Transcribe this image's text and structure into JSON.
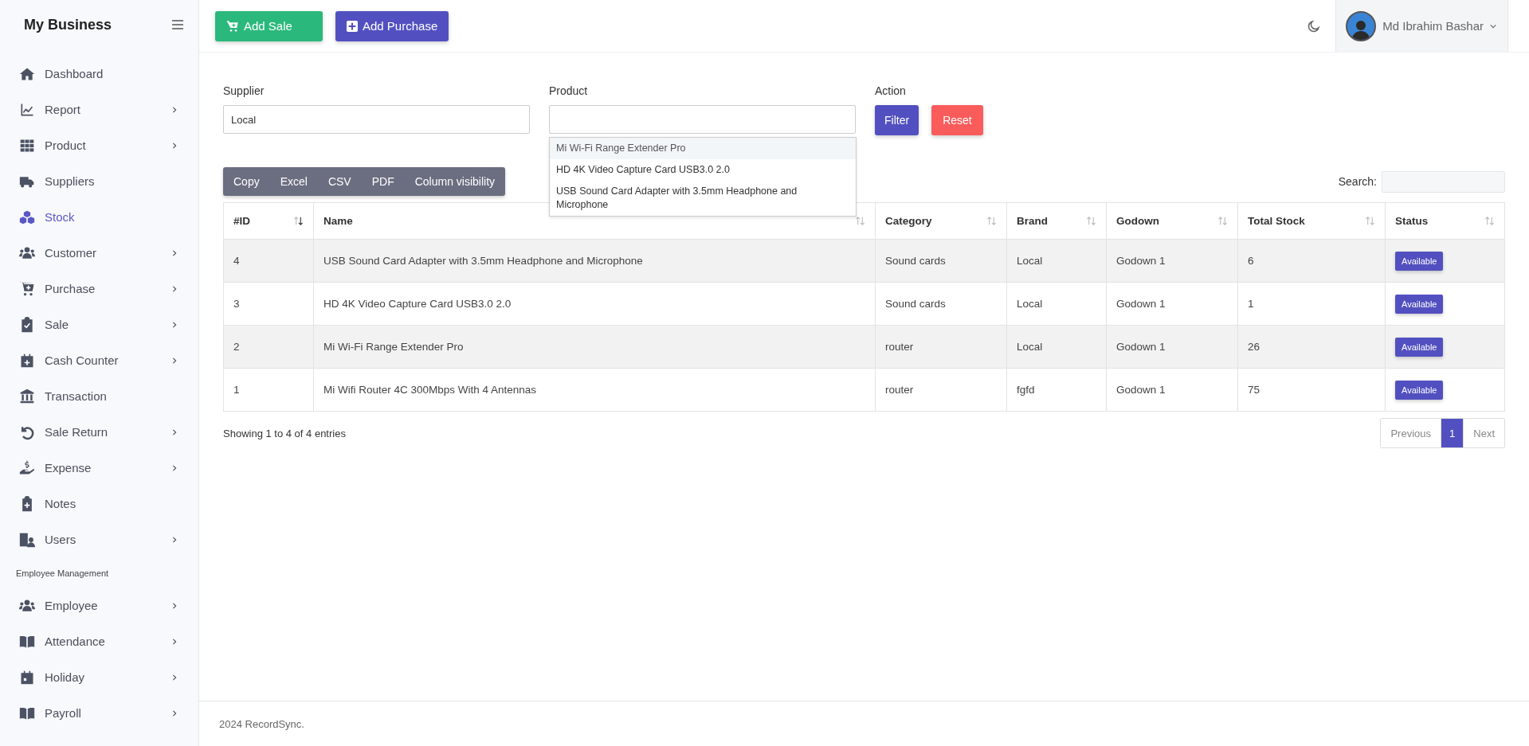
{
  "sidebar": {
    "brand": "My Business",
    "items": [
      {
        "kind": "link",
        "label": "Dashboard",
        "expandable": false,
        "selected": false
      },
      {
        "kind": "link",
        "label": "Report",
        "expandable": true,
        "selected": false
      },
      {
        "kind": "link",
        "label": "Product",
        "expandable": true,
        "selected": false
      },
      {
        "kind": "link",
        "label": "Suppliers",
        "expandable": false,
        "selected": false
      },
      {
        "kind": "link",
        "label": "Stock",
        "expandable": false,
        "selected": true
      },
      {
        "kind": "link",
        "label": "Customer",
        "expandable": true,
        "selected": false
      },
      {
        "kind": "link",
        "label": "Purchase",
        "expandable": true,
        "selected": false
      },
      {
        "kind": "link",
        "label": "Sale",
        "expandable": true,
        "selected": false
      },
      {
        "kind": "link",
        "label": "Cash Counter",
        "expandable": true,
        "selected": false
      },
      {
        "kind": "link",
        "label": "Transaction",
        "expandable": false,
        "selected": false
      },
      {
        "kind": "link",
        "label": "Sale Return",
        "expandable": true,
        "selected": false
      },
      {
        "kind": "link",
        "label": "Expense",
        "expandable": true,
        "selected": false
      },
      {
        "kind": "link",
        "label": "Notes",
        "expandable": false,
        "selected": false
      },
      {
        "kind": "link",
        "label": "Users",
        "expandable": true,
        "selected": false
      },
      {
        "kind": "heading",
        "label": "Employee Management"
      },
      {
        "kind": "link",
        "label": "Employee",
        "expandable": true,
        "selected": false
      },
      {
        "kind": "link",
        "label": "Attendance",
        "expandable": true,
        "selected": false
      },
      {
        "kind": "link",
        "label": "Holiday",
        "expandable": true,
        "selected": false
      },
      {
        "kind": "link",
        "label": "Payroll",
        "expandable": true,
        "selected": false
      }
    ]
  },
  "topbar": {
    "buttons": [
      {
        "kind": "sale",
        "label": "Add Sale"
      },
      {
        "kind": "purchase",
        "label": "Add Purchase"
      }
    ],
    "user": "Md Ibrahim Bashar"
  },
  "filters": {
    "supplier": {
      "label": "Supplier",
      "value": "Local"
    },
    "product": {
      "label": "Product",
      "suggestions": [
        {
          "label": "Mi Wi-Fi Range Extender Pro",
          "selected": true
        },
        {
          "label": "HD 4K Video Capture Card USB3.0 2.0",
          "selected": false
        },
        {
          "label": "USB Sound Card Adapter with 3.5mm Headphone and Microphone",
          "selected": false
        }
      ]
    },
    "action": {
      "label": "Action",
      "buttons": [
        {
          "kind": "filter",
          "label": "Filter"
        },
        {
          "kind": "reset",
          "label": "Reset"
        }
      ]
    }
  },
  "table_tools": {
    "export_buttons": [
      "Copy",
      "Excel",
      "CSV",
      "PDF",
      "Column visibility"
    ],
    "search_label": "Search:"
  },
  "table": {
    "columns": [
      {
        "label": "#ID",
        "sorted": true
      },
      {
        "label": "Name",
        "sorted": false
      },
      {
        "label": "Category",
        "sorted": false
      },
      {
        "label": "Brand",
        "sorted": false
      },
      {
        "label": "Godown",
        "sorted": false
      },
      {
        "label": "Total Stock",
        "sorted": false
      },
      {
        "label": "Status",
        "sorted": false
      }
    ],
    "rows": [
      {
        "id": "4",
        "name": "USB Sound Card Adapter with 3.5mm Headphone and Microphone",
        "category": "Sound cards",
        "brand": "Local",
        "godown": "Godown 1",
        "total_stock": "6",
        "status": "Available"
      },
      {
        "id": "3",
        "name": "HD 4K Video Capture Card USB3.0 2.0",
        "category": "Sound cards",
        "brand": "Local",
        "godown": "Godown 1",
        "total_stock": "1",
        "status": "Available"
      },
      {
        "id": "2",
        "name": "Mi Wi-Fi Range Extender Pro",
        "category": "router",
        "brand": "Local",
        "godown": "Godown 1",
        "total_stock": "26",
        "status": "Available"
      },
      {
        "id": "1",
        "name": "Mi Wifi Router 4C 300Mbps With 4 Antennas",
        "category": "router",
        "brand": "fgfd",
        "godown": "Godown 1",
        "total_stock": "75",
        "status": "Available"
      }
    ]
  },
  "table_info": "Showing 1 to 4 of 4 entries",
  "pagination": [
    {
      "label": "Previous",
      "selected": false
    },
    {
      "label": "1",
      "selected": true
    },
    {
      "label": "Next",
      "selected": false
    }
  ],
  "footer": "2024 RecordSync."
}
